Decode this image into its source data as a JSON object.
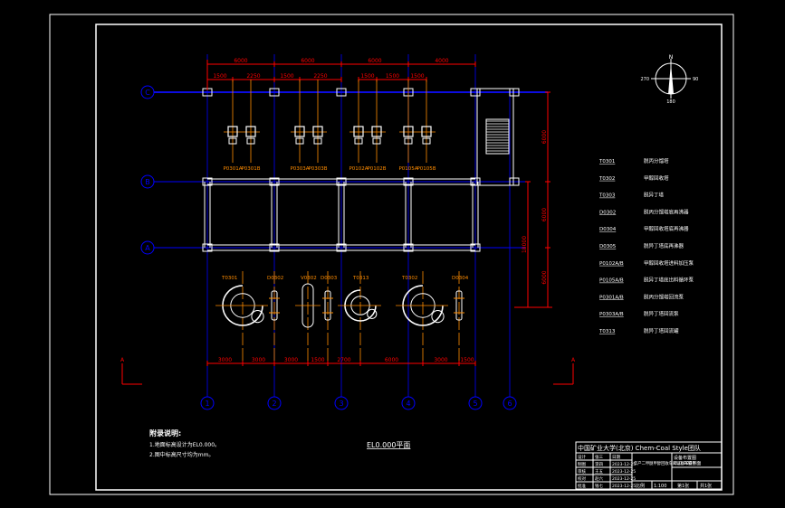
{
  "colors": {
    "background": "#000000",
    "frame": "#ffffff",
    "axis": "#0000ff",
    "dimension": "#ff0000",
    "centerline": "#ff8c00",
    "equipment": "#ffffff"
  },
  "drawing_title": "EL0.000平面",
  "notes": {
    "heading": "附录说明:",
    "lines": [
      "1.地面标高设计为EL0.000。",
      "2.图中标高尺寸均为mm。"
    ]
  },
  "row_axes": [
    "C",
    "B",
    "A"
  ],
  "column_axes": [
    "1",
    "2",
    "3",
    "4",
    "5",
    "6"
  ],
  "section_mark": "A",
  "top_dims": [
    "6000",
    "6000",
    "6000",
    "4000"
  ],
  "sub_dims": [
    "1500",
    "2250",
    "1500",
    "2250",
    "1500",
    "1500",
    "1500"
  ],
  "right_dims": [
    "6000",
    "6000",
    "6000"
  ],
  "right_total": "18000",
  "bottom_dims": [
    "3000",
    "3000",
    "3000",
    "1500",
    "2700",
    "6000",
    "3000",
    "1500"
  ],
  "pump_labels": [
    "P0301A",
    "P0301B",
    "P0303A",
    "P0303B",
    "P0102A",
    "P0102B",
    "P0105A",
    "P0105B"
  ],
  "equipment_labels": [
    "T0301",
    "D0302",
    "V0302",
    "D0303",
    "T0313",
    "T0302",
    "D0304"
  ],
  "compass": {
    "north": "N",
    "west": "270",
    "east": "90",
    "south": "180"
  },
  "legend": [
    {
      "code": "T0301",
      "desc": "脱丙分馏塔"
    },
    {
      "code": "T0302",
      "desc": "甲醇回收塔"
    },
    {
      "code": "T0303",
      "desc": "脱异丁塔"
    },
    {
      "code": "D0302",
      "desc": "脱丙分馏塔底再沸器"
    },
    {
      "code": "D0304",
      "desc": "甲醇回收塔底再沸器"
    },
    {
      "code": "D0305",
      "desc": "脱异丁塔底再沸器"
    },
    {
      "code": "P0102A/B",
      "desc": "甲醇回收塔进料加压泵"
    },
    {
      "code": "P0105A/B",
      "desc": "脱异丁塔底出料循环泵"
    },
    {
      "code": "P0301A/B",
      "desc": "脱丙分馏塔回流泵"
    },
    {
      "code": "P0303A/B",
      "desc": "脱异丁塔回流泵"
    },
    {
      "code": "T0313",
      "desc": "脱异丁塔回流罐"
    }
  ],
  "title_block": {
    "school": "中国矿业大学(北京) Chem-Coal Style团队",
    "project": "年产二甲醚甲醇回收车间设备布置图",
    "rows": [
      [
        "设计",
        "张三",
        "日期"
      ],
      [
        "制图",
        "李四",
        "2023-12-25"
      ],
      [
        "审核",
        "王五",
        "2023-12-25"
      ],
      [
        "校对",
        "赵六",
        "2023-12-25"
      ],
      [
        "批准",
        "钱七",
        "2023-12-25"
      ]
    ],
    "right_top": [
      "设备布置图",
      "EL0.000平面"
    ],
    "scale_label": "比例",
    "scale": "1:100",
    "sheet_label": "第1张",
    "total_label": "共1张"
  }
}
